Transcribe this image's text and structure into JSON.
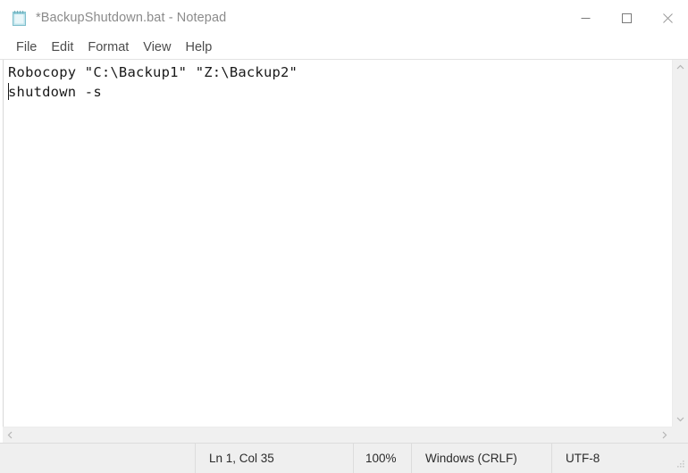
{
  "window": {
    "title": "*BackupShutdown.bat - Notepad",
    "app_icon": "notepad-icon",
    "controls": {
      "minimize": "minimize-icon",
      "maximize": "maximize-icon",
      "close": "close-icon"
    }
  },
  "menubar": {
    "items": [
      {
        "label": "File"
      },
      {
        "label": "Edit"
      },
      {
        "label": "Format"
      },
      {
        "label": "View"
      },
      {
        "label": "Help"
      }
    ]
  },
  "editor": {
    "lines": [
      "Robocopy \"C:\\Backup1\" \"Z:\\Backup2\"",
      "shutdown -s"
    ]
  },
  "scrollbars": {
    "vertical": {
      "up": "chevron-up-icon",
      "down": "chevron-down-icon"
    },
    "horizontal": {
      "left": "chevron-left-icon",
      "right": "chevron-right-icon"
    }
  },
  "statusbar": {
    "position": "Ln 1, Col 35",
    "zoom": "100%",
    "line_ending": "Windows (CRLF)",
    "encoding": "UTF-8"
  },
  "colors": {
    "window_bg": "#ffffff",
    "title_text": "#8b8b8b",
    "menu_text": "#4c4c4c",
    "code_text": "#1a1a1a",
    "statusbar_bg": "#efefef",
    "scrollbar_bg": "#f0f0f0",
    "border": "#dcdcdc",
    "icon_accent": "#9fd6e0"
  }
}
